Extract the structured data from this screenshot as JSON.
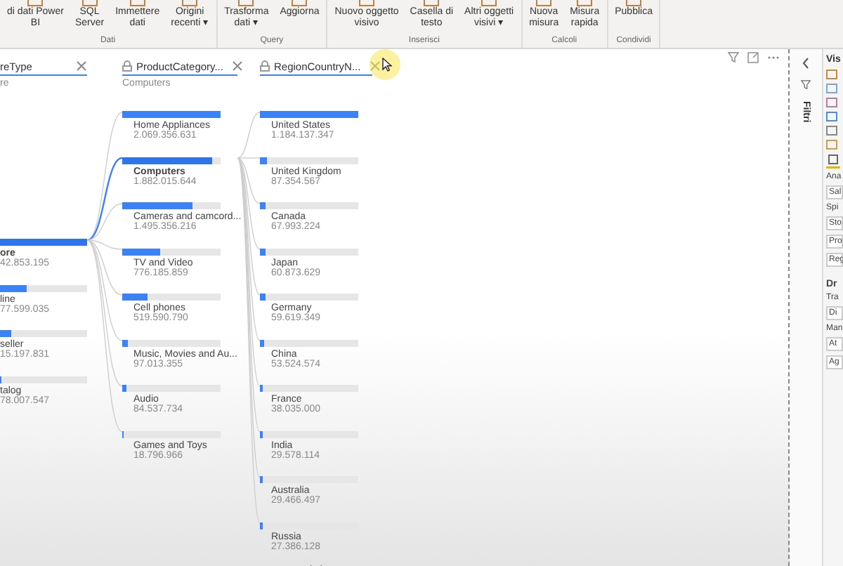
{
  "ribbon": {
    "groups": [
      {
        "label": "Dati",
        "buttons": [
          {
            "label": "di dati Power\nBI"
          },
          {
            "label": "SQL\nServer"
          },
          {
            "label": "Immettere\ndati"
          },
          {
            "label": "Origini\nrecenti ▾"
          }
        ]
      },
      {
        "label": "Query",
        "buttons": [
          {
            "label": "Trasforma\ndati ▾"
          },
          {
            "label": "Aggiorna"
          }
        ]
      },
      {
        "label": "Inserisci",
        "buttons": [
          {
            "label": "Nuovo oggetto\nvisivo"
          },
          {
            "label": "Casella di\ntesto"
          },
          {
            "label": "Altri oggetti\nvisivi ▾"
          }
        ]
      },
      {
        "label": "Calcoli",
        "buttons": [
          {
            "label": "Nuova\nmisura"
          },
          {
            "label": "Misura\nrapida"
          }
        ]
      },
      {
        "label": "Condividi",
        "buttons": [
          {
            "label": "Pubblica"
          }
        ]
      }
    ]
  },
  "tree": {
    "columns": [
      {
        "header": "reType",
        "locked": false,
        "subtitle": "re",
        "items": [
          {
            "name": "ore",
            "value": "42.853.195",
            "level": 1,
            "selected": true
          },
          {
            "name": "line",
            "value": "77.599.035",
            "level": 0.3,
            "selected": false
          },
          {
            "name": "seller",
            "value": "15.197.831",
            "level": 0.13,
            "selected": false
          },
          {
            "name": "talog",
            "value": "78.007.547",
            "level": 0.02,
            "selected": false
          }
        ]
      },
      {
        "header": "ProductCategory...",
        "locked": true,
        "subtitle": "Computers",
        "items": [
          {
            "name": "Home Appliances",
            "value": "2.069.356.631",
            "level": 1,
            "selected": false
          },
          {
            "name": "Computers",
            "value": "1.882.015.644",
            "level": 0.91,
            "selected": true
          },
          {
            "name": "Cameras and camcord...",
            "value": "1.495.356.216",
            "level": 0.72,
            "selected": false
          },
          {
            "name": "TV and Video",
            "value": "776.185.859",
            "level": 0.38,
            "selected": false
          },
          {
            "name": "Cell phones",
            "value": "519.590.790",
            "level": 0.25,
            "selected": false
          },
          {
            "name": "Music, Movies and Au...",
            "value": "97.013.355",
            "level": 0.05,
            "selected": false
          },
          {
            "name": "Audio",
            "value": "84.537.734",
            "level": 0.04,
            "selected": false
          },
          {
            "name": "Games and Toys",
            "value": "18.796.966",
            "level": 0.01,
            "selected": false
          }
        ]
      },
      {
        "header": "RegionCountryN...",
        "locked": true,
        "items": [
          {
            "name": "United States",
            "value": "1.184.137.347",
            "level": 1,
            "selected": false
          },
          {
            "name": "United Kingdom",
            "value": "87.354.567",
            "level": 0.07,
            "selected": false
          },
          {
            "name": "Canada",
            "value": "67.993.224",
            "level": 0.06,
            "selected": false
          },
          {
            "name": "Japan",
            "value": "60.873.629",
            "level": 0.05,
            "selected": false
          },
          {
            "name": "Germany",
            "value": "59.619.349",
            "level": 0.05,
            "selected": false
          },
          {
            "name": "China",
            "value": "53.524.574",
            "level": 0.045,
            "selected": false
          },
          {
            "name": "France",
            "value": "38.035.000",
            "level": 0.032,
            "selected": false
          },
          {
            "name": "India",
            "value": "29.578.114",
            "level": 0.025,
            "selected": false
          },
          {
            "name": "Australia",
            "value": "29.466.497",
            "level": 0.025,
            "selected": false
          },
          {
            "name": "Russia",
            "value": "27.386.128",
            "level": 0.023,
            "selected": false
          }
        ]
      }
    ]
  },
  "filters_pane": {
    "label": "Filtri"
  },
  "visualizations_pane": {
    "title": "Vis",
    "items": [
      {
        "kind": "label",
        "text": "Ana"
      },
      {
        "kind": "well",
        "text": "Sal"
      },
      {
        "kind": "label",
        "text": "Spi"
      },
      {
        "kind": "well",
        "text": "Sto"
      },
      {
        "kind": "well",
        "text": "Pro"
      },
      {
        "kind": "well",
        "text": "Reg"
      },
      {
        "kind": "heading",
        "text": "Dr"
      },
      {
        "kind": "label",
        "text": "Tra"
      },
      {
        "kind": "well",
        "text": "Di"
      },
      {
        "kind": "label",
        "text": "Man"
      },
      {
        "kind": "well",
        "text": "At"
      },
      {
        "kind": "well",
        "text": "Ag"
      }
    ]
  }
}
